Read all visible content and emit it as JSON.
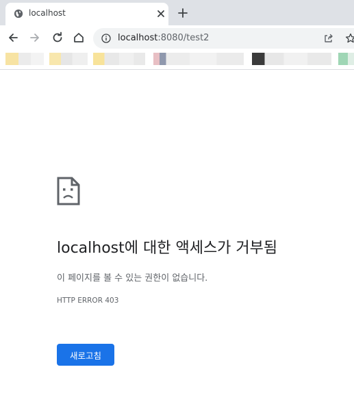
{
  "browser": {
    "tab": {
      "title": "localhost",
      "favicon": "globe-icon"
    },
    "omnibox": {
      "host": "localhost",
      "rest": ":8080/test2"
    },
    "icons": [
      "back-icon",
      "forward-icon",
      "reload-icon",
      "home-icon",
      "info-icon",
      "share-icon",
      "star-icon",
      "close-icon",
      "plus-icon"
    ]
  },
  "error_page": {
    "title": "localhost에 대한 액세스가 거부됨",
    "description": "이 페이지를 볼 수 있는 권한이 없습니다.",
    "error_code": "HTTP ERROR 403",
    "reload_label": "새로고침",
    "icon": "sad-page-icon"
  },
  "colors": {
    "accent": "#1a73e8",
    "tabstrip": "#dee1e6",
    "omnibox": "#f1f3f4"
  }
}
